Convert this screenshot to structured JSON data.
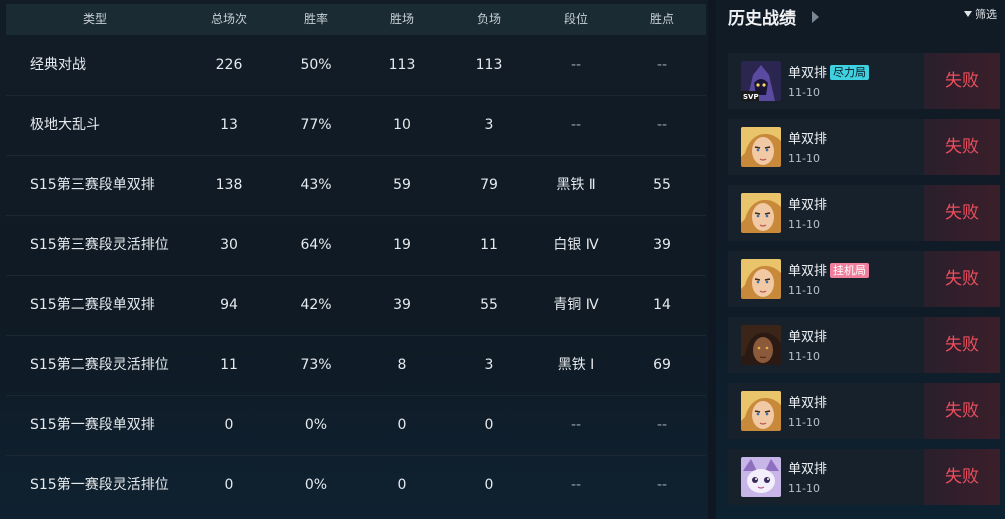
{
  "table": {
    "headers": {
      "type": "类型",
      "total": "总场次",
      "winrate": "胜率",
      "wins": "胜场",
      "losses": "负场",
      "tier": "段位",
      "lp": "胜点"
    },
    "rows": [
      {
        "type": "经典对战",
        "total": "226",
        "winrate": "50%",
        "wins": "113",
        "losses": "113",
        "tier": "--",
        "lp": "--"
      },
      {
        "type": "极地大乱斗",
        "total": "13",
        "winrate": "77%",
        "wins": "10",
        "losses": "3",
        "tier": "--",
        "lp": "--"
      },
      {
        "type": "S15第三赛段单双排",
        "total": "138",
        "winrate": "43%",
        "wins": "59",
        "losses": "79",
        "tier": "黑铁 Ⅱ",
        "lp": "55"
      },
      {
        "type": "S15第三赛段灵活排位",
        "total": "30",
        "winrate": "64%",
        "wins": "19",
        "losses": "11",
        "tier": "白银 Ⅳ",
        "lp": "39"
      },
      {
        "type": "S15第二赛段单双排",
        "total": "94",
        "winrate": "42%",
        "wins": "39",
        "losses": "55",
        "tier": "青铜 Ⅳ",
        "lp": "14"
      },
      {
        "type": "S15第二赛段灵活排位",
        "total": "11",
        "winrate": "73%",
        "wins": "8",
        "losses": "3",
        "tier": "黑铁 Ⅰ",
        "lp": "69"
      },
      {
        "type": "S15第一赛段单双排",
        "total": "0",
        "winrate": "0%",
        "wins": "0",
        "losses": "0",
        "tier": "--",
        "lp": "--"
      },
      {
        "type": "S15第一赛段灵活排位",
        "total": "0",
        "winrate": "0%",
        "wins": "0",
        "losses": "0",
        "tier": "--",
        "lp": "--"
      }
    ]
  },
  "history": {
    "title": "历史战绩",
    "filter_label": "筛选",
    "matches": [
      {
        "mode": "单双排",
        "tag": "尽力局",
        "tag_color": "#3fd1e0",
        "date": "11-10",
        "result": "失败",
        "avatar": "dark-mage-champion-icon",
        "badge": "SVP"
      },
      {
        "mode": "单双排",
        "tag": "",
        "date": "11-10",
        "result": "失败",
        "avatar": "blonde-champion-icon"
      },
      {
        "mode": "单双排",
        "tag": "",
        "date": "11-10",
        "result": "失败",
        "avatar": "blonde-champion-icon"
      },
      {
        "mode": "单双排",
        "tag": "挂机局",
        "tag_color": "#f07f9e",
        "date": "11-10",
        "result": "失败",
        "avatar": "blonde-champion-icon"
      },
      {
        "mode": "单双排",
        "tag": "",
        "date": "11-10",
        "result": "失败",
        "avatar": "dark-haired-champion-icon"
      },
      {
        "mode": "单双排",
        "tag": "",
        "date": "11-10",
        "result": "失败",
        "avatar": "blonde-champion-icon"
      },
      {
        "mode": "单双排",
        "tag": "",
        "date": "11-10",
        "result": "失败",
        "avatar": "yordle-champion-icon"
      }
    ]
  },
  "colors": {
    "loss": "#ec4f5e",
    "header_bg": "#1a2b33"
  }
}
